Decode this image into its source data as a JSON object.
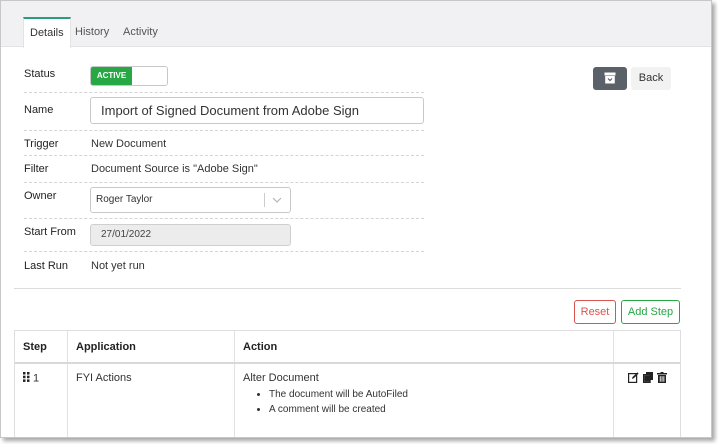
{
  "tabs": [
    {
      "label": "Details",
      "active": true
    },
    {
      "label": "History",
      "active": false
    },
    {
      "label": "Activity",
      "active": false
    }
  ],
  "details": {
    "status_label": "Status",
    "status_value": "ACTIVE",
    "name_label": "Name",
    "name_value": "Import of Signed Document from Adobe Sign",
    "trigger_label": "Trigger",
    "trigger_value": "New Document",
    "filter_label": "Filter",
    "filter_value": "Document Source is \"Adobe Sign\"",
    "owner_label": "Owner",
    "owner_value": "Roger Taylor",
    "start_label": "Start From",
    "start_value": "27/01/2022",
    "lastrun_label": "Last Run",
    "lastrun_value": "Not yet run"
  },
  "buttons": {
    "back": "Back",
    "reset": "Reset",
    "add_step": "Add Step"
  },
  "steps_table": {
    "headers": [
      "Step",
      "Application",
      "Action"
    ],
    "rows": [
      {
        "step": "1",
        "application": "FYI Actions",
        "action": "Alter Document",
        "details": [
          "The document will be AutoFiled",
          "A comment will be created"
        ]
      }
    ]
  },
  "colors": {
    "accent_tab": "#2a9d7c",
    "active_green": "#27a844",
    "danger": "#d9534f",
    "success": "#28a745",
    "archive_button": "#5a6168"
  },
  "icons": [
    "archive-icon",
    "chevron-down-icon",
    "drag-handle-icon",
    "edit-icon",
    "copy-icon",
    "delete-icon"
  ]
}
